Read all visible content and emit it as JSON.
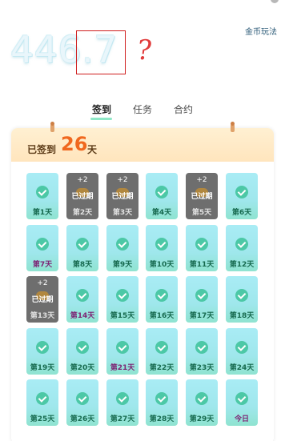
{
  "header": {
    "coins": "446.7",
    "rules_link": "金币玩法"
  },
  "annotation": {
    "mark": "?"
  },
  "tabs": [
    {
      "label": "签到",
      "active": true
    },
    {
      "label": "任务",
      "active": false
    },
    {
      "label": "合约",
      "active": false
    }
  ],
  "checkin": {
    "prefix": "已签到",
    "days": "26",
    "suffix": "天",
    "cells": [
      {
        "label": "第1天",
        "status": "signed"
      },
      {
        "label": "第2天",
        "status": "expired",
        "reward": "+2",
        "badge": "已过期"
      },
      {
        "label": "第3天",
        "status": "expired",
        "reward": "+2",
        "badge": "已过期"
      },
      {
        "label": "第4天",
        "status": "signed"
      },
      {
        "label": "第5天",
        "status": "expired",
        "reward": "+2",
        "badge": "已过期"
      },
      {
        "label": "第6天",
        "status": "signed"
      },
      {
        "label": "第7天",
        "status": "signed",
        "alt": true
      },
      {
        "label": "第8天",
        "status": "signed"
      },
      {
        "label": "第9天",
        "status": "signed"
      },
      {
        "label": "第10天",
        "status": "signed"
      },
      {
        "label": "第11天",
        "status": "signed"
      },
      {
        "label": "第12天",
        "status": "signed"
      },
      {
        "label": "第13天",
        "status": "expired",
        "reward": "+2",
        "badge": "已过期"
      },
      {
        "label": "第14天",
        "status": "signed",
        "alt": true
      },
      {
        "label": "第15天",
        "status": "signed"
      },
      {
        "label": "第16天",
        "status": "signed"
      },
      {
        "label": "第17天",
        "status": "signed"
      },
      {
        "label": "第18天",
        "status": "signed"
      },
      {
        "label": "第19天",
        "status": "signed"
      },
      {
        "label": "第20天",
        "status": "signed"
      },
      {
        "label": "第21天",
        "status": "signed",
        "alt": true
      },
      {
        "label": "第22天",
        "status": "signed"
      },
      {
        "label": "第23天",
        "status": "signed"
      },
      {
        "label": "第24天",
        "status": "signed"
      },
      {
        "label": "第25天",
        "status": "signed"
      },
      {
        "label": "第26天",
        "status": "signed"
      },
      {
        "label": "第27天",
        "status": "signed"
      },
      {
        "label": "第28天",
        "status": "signed"
      },
      {
        "label": "第29天",
        "status": "signed"
      },
      {
        "label": "今日",
        "status": "signed",
        "alt": true
      }
    ]
  },
  "colors": {
    "accent": "#8fe8c7",
    "signed_days": "#f0681f",
    "expired_cell": "#6e6e6e"
  }
}
